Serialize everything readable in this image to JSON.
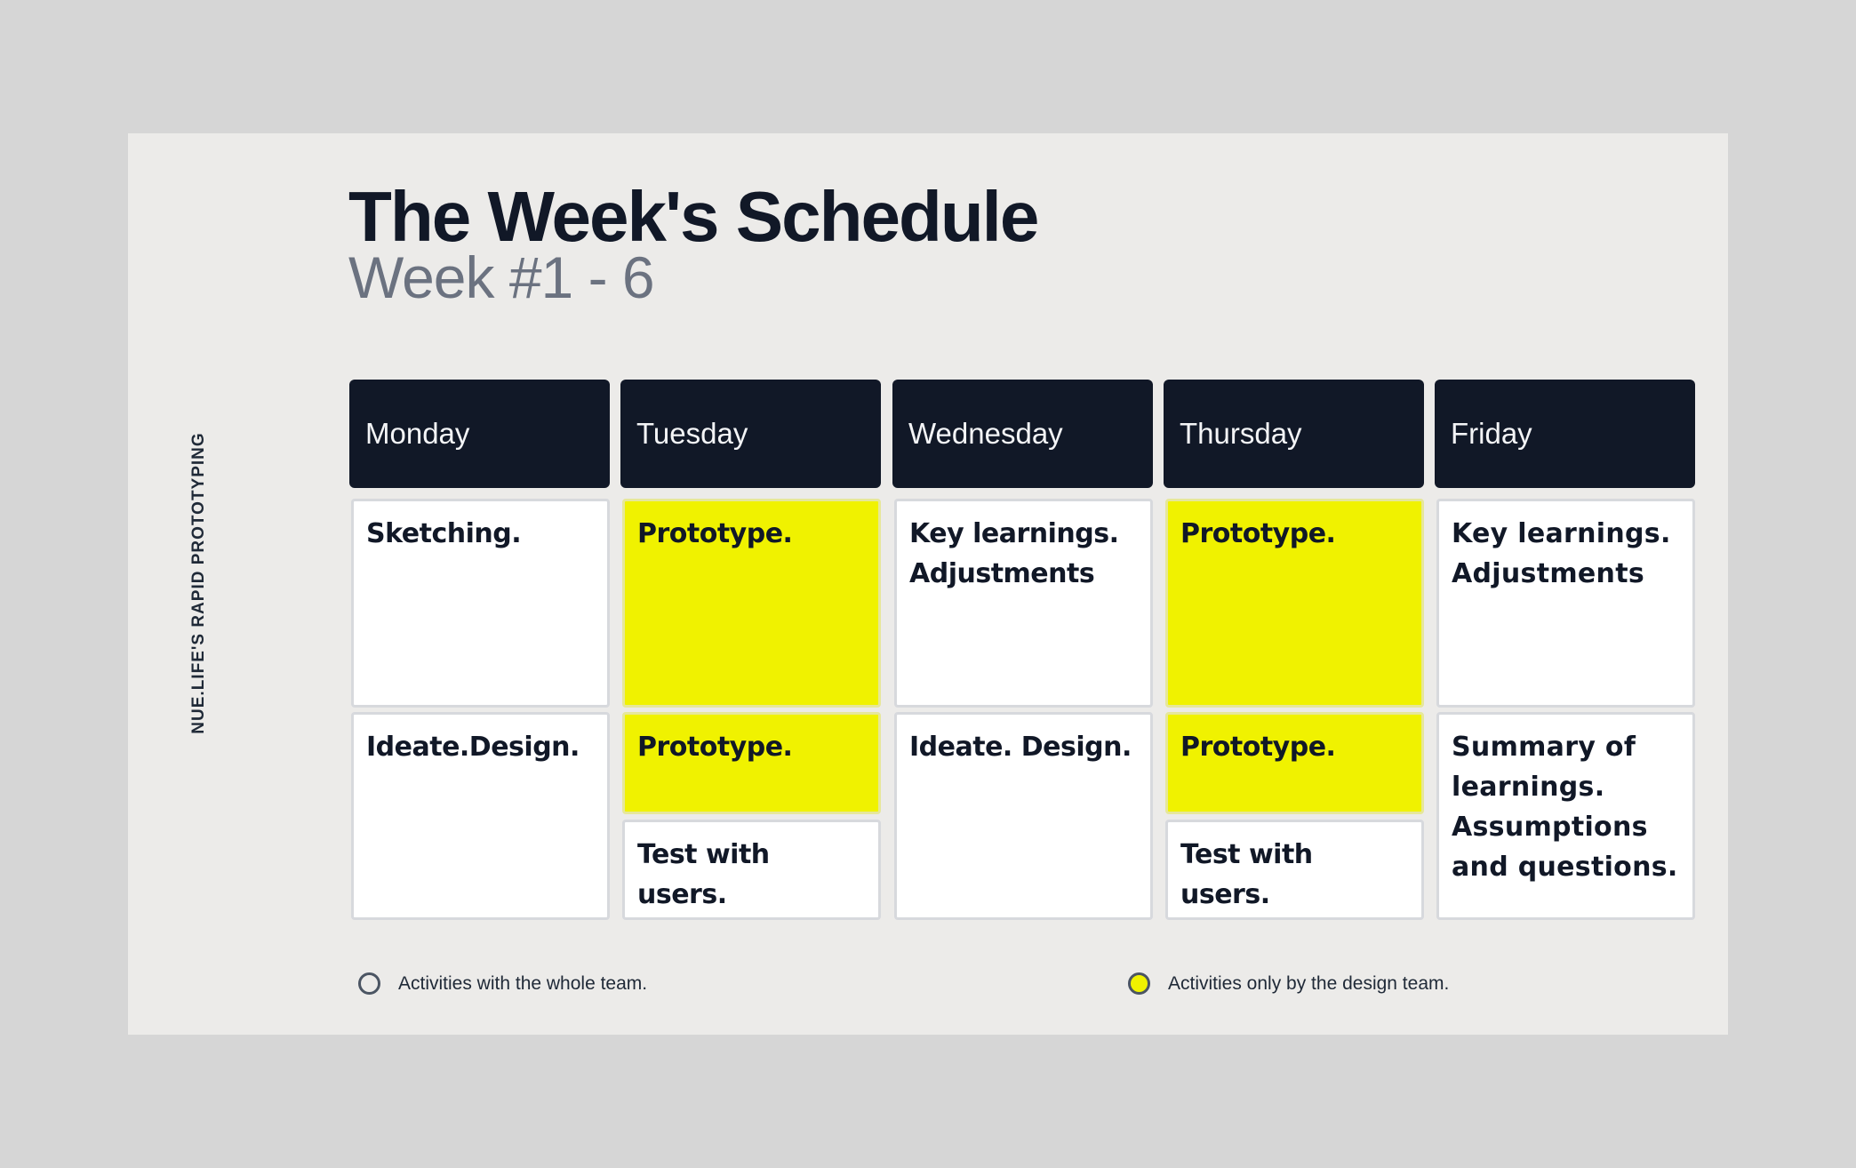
{
  "side_label": "NUE.LIFE'S  RAPID PROTOTYPING",
  "title": "The Week's Schedule",
  "subtitle": "Week #1 - 6",
  "colors": {
    "header_bg": "#111827",
    "design_team_highlight": "#F0F200",
    "whole_team_bg": "#FFFFFF",
    "slide_bg": "#ECEBE9",
    "page_bg": "#D6D6D6"
  },
  "schedule": {
    "days": [
      {
        "name": "Monday",
        "activities": [
          {
            "text": "Sketching.",
            "team": "whole"
          },
          {
            "text": "Ideate.Design.",
            "team": "whole"
          }
        ]
      },
      {
        "name": "Tuesday",
        "activities": [
          {
            "text": "Prototype.",
            "team": "design"
          },
          {
            "text": "Prototype.",
            "team": "design"
          },
          {
            "text": "Test with users.",
            "team": "whole"
          }
        ]
      },
      {
        "name": "Wednesday",
        "activities": [
          {
            "text": "Key learnings. Adjustments",
            "team": "whole"
          },
          {
            "text": "Ideate. Design.",
            "team": "whole"
          }
        ]
      },
      {
        "name": "Thursday",
        "activities": [
          {
            "text": "Prototype.",
            "team": "design"
          },
          {
            "text": "Prototype.",
            "team": "design"
          },
          {
            "text": "Test with users.",
            "team": "whole"
          }
        ]
      },
      {
        "name": "Friday",
        "activities": [
          {
            "text": "Key learnings. Adjustments",
            "team": "whole"
          },
          {
            "text": "Summary of learnings. Assumptions and questions.",
            "team": "whole"
          }
        ]
      }
    ]
  },
  "legend": [
    {
      "marker": "hollow-circle",
      "label": "Activities with the whole team."
    },
    {
      "marker": "yellow-circle",
      "label": "Activities only by the design team."
    }
  ]
}
